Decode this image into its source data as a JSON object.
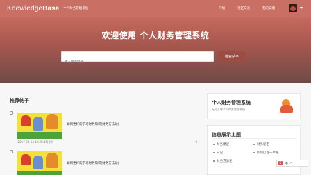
{
  "header": {
    "brand_part1": "Knowledge",
    "brand_part2": "Base",
    "brand_subtitle": "个人财务管理系统",
    "nav": [
      "介绍",
      "社区交流",
      "我的说明"
    ]
  },
  "hero": {
    "title": "欢迎使用 个人财务管理系统",
    "search_placeholder": "输入你的疑惑",
    "search_button": "搜索帖子"
  },
  "posts_section": {
    "title": "推荐帖子",
    "posts": [
      {
        "title": "如何更好的学习财务知识(财务方法论)",
        "meta": "(2017-03-13 12:28:15)  [0]",
        "likes": "0"
      },
      {
        "title": "如何更好的学习财务知识(财务方法论)",
        "meta": "",
        "likes": ""
      }
    ]
  },
  "sidebar": {
    "card_title": "个人财务管理系统",
    "card_subtitle": "无论从哪个人财务管理系统",
    "info_title": "信息展示主题",
    "items": [
      "财务建议",
      "财务秘密",
      "日记",
      "如何打理一本账",
      "财务方法论"
    ]
  },
  "ime": {
    "label": "S",
    "icons": "中 ·°"
  }
}
